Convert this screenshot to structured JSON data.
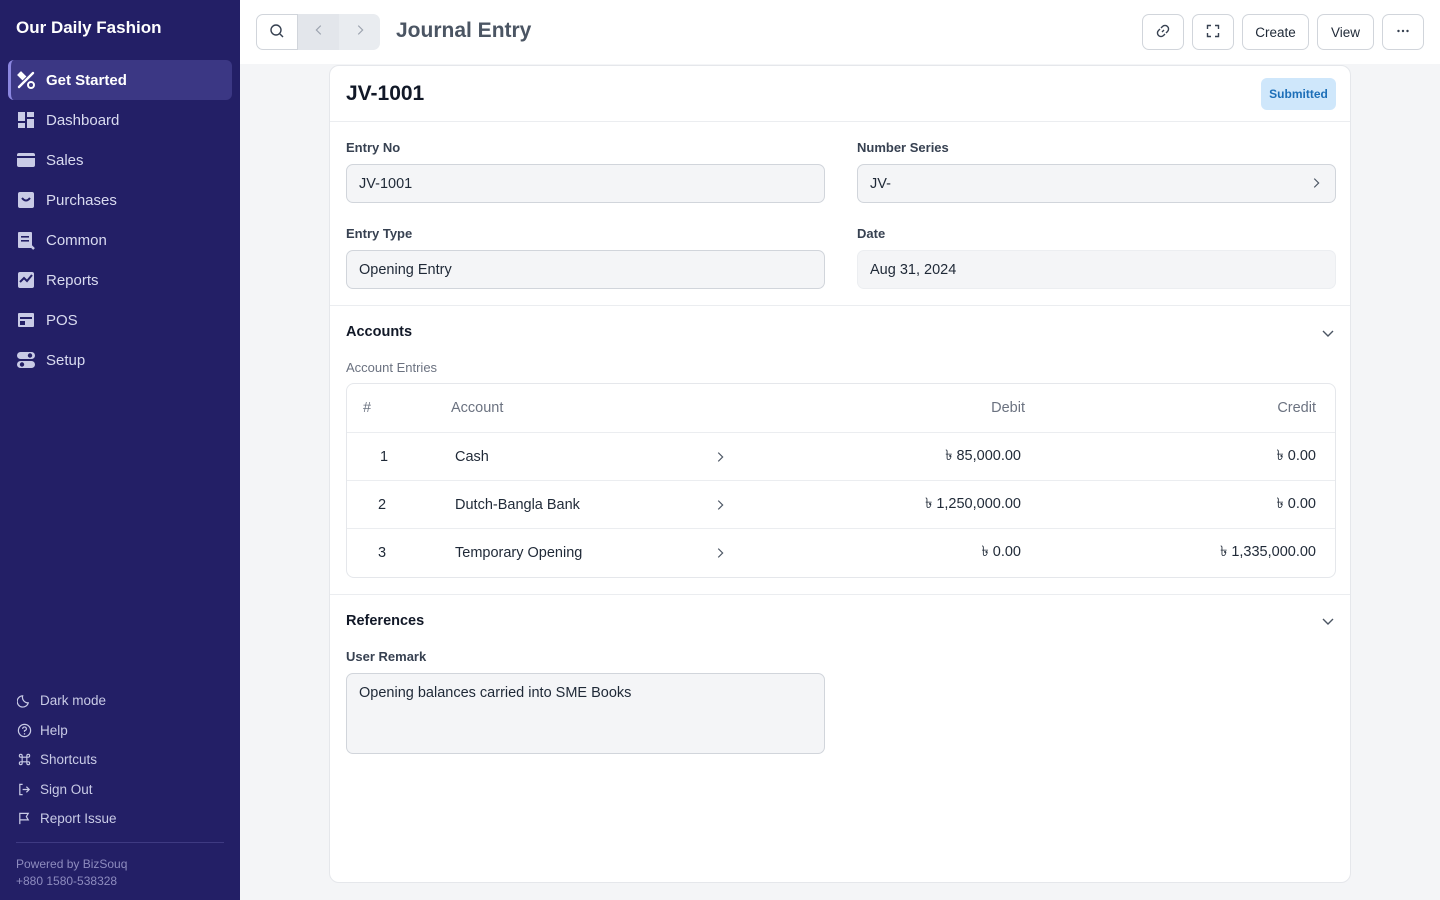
{
  "sidebar": {
    "brand": "Our Daily Fashion",
    "items": [
      {
        "label": "Get Started",
        "icon": "tools-icon",
        "active": true
      },
      {
        "label": "Dashboard",
        "icon": "dashboard-icon"
      },
      {
        "label": "Sales",
        "icon": "sales-icon"
      },
      {
        "label": "Purchases",
        "icon": "purchases-icon"
      },
      {
        "label": "Common",
        "icon": "common-icon"
      },
      {
        "label": "Reports",
        "icon": "reports-icon"
      },
      {
        "label": "POS",
        "icon": "pos-icon"
      },
      {
        "label": "Setup",
        "icon": "setup-icon"
      }
    ],
    "bottom": [
      {
        "label": "Dark mode",
        "icon": "moon-icon"
      },
      {
        "label": "Help",
        "icon": "help-icon"
      },
      {
        "label": "Shortcuts",
        "icon": "command-icon"
      },
      {
        "label": "Sign Out",
        "icon": "sign-out-icon"
      },
      {
        "label": "Report Issue",
        "icon": "flag-icon"
      }
    ],
    "powered_by": "Powered by BizSouq",
    "phone": "+880 1580-538328"
  },
  "topbar": {
    "title": "Journal Entry",
    "create_label": "Create",
    "view_label": "View"
  },
  "doc": {
    "title": "JV-1001",
    "status": "Submitted",
    "entry_no_label": "Entry No",
    "entry_no": "JV-1001",
    "number_series_label": "Number Series",
    "number_series": "JV-",
    "entry_type_label": "Entry Type",
    "entry_type": "Opening Entry",
    "date_label": "Date",
    "date": "Aug 31, 2024"
  },
  "accounts": {
    "section_title": "Accounts",
    "table_label": "Account Entries",
    "columns": {
      "num": "#",
      "account": "Account",
      "debit": "Debit",
      "credit": "Credit"
    },
    "rows": [
      {
        "num": "1",
        "account": "Cash",
        "debit": "৳ 85,000.00",
        "credit": "৳ 0.00"
      },
      {
        "num": "2",
        "account": "Dutch-Bangla Bank",
        "debit": "৳ 1,250,000.00",
        "credit": "৳ 0.00"
      },
      {
        "num": "3",
        "account": "Temporary Opening",
        "debit": "৳ 0.00",
        "credit": "৳ 1,335,000.00"
      }
    ]
  },
  "references": {
    "section_title": "References",
    "remark_label": "User Remark",
    "remark": "Opening balances carried into SME Books"
  },
  "colors": {
    "sidebar_bg": "#231f66",
    "badge_bg": "#cfe7fb",
    "badge_text": "#1d6fb8"
  }
}
